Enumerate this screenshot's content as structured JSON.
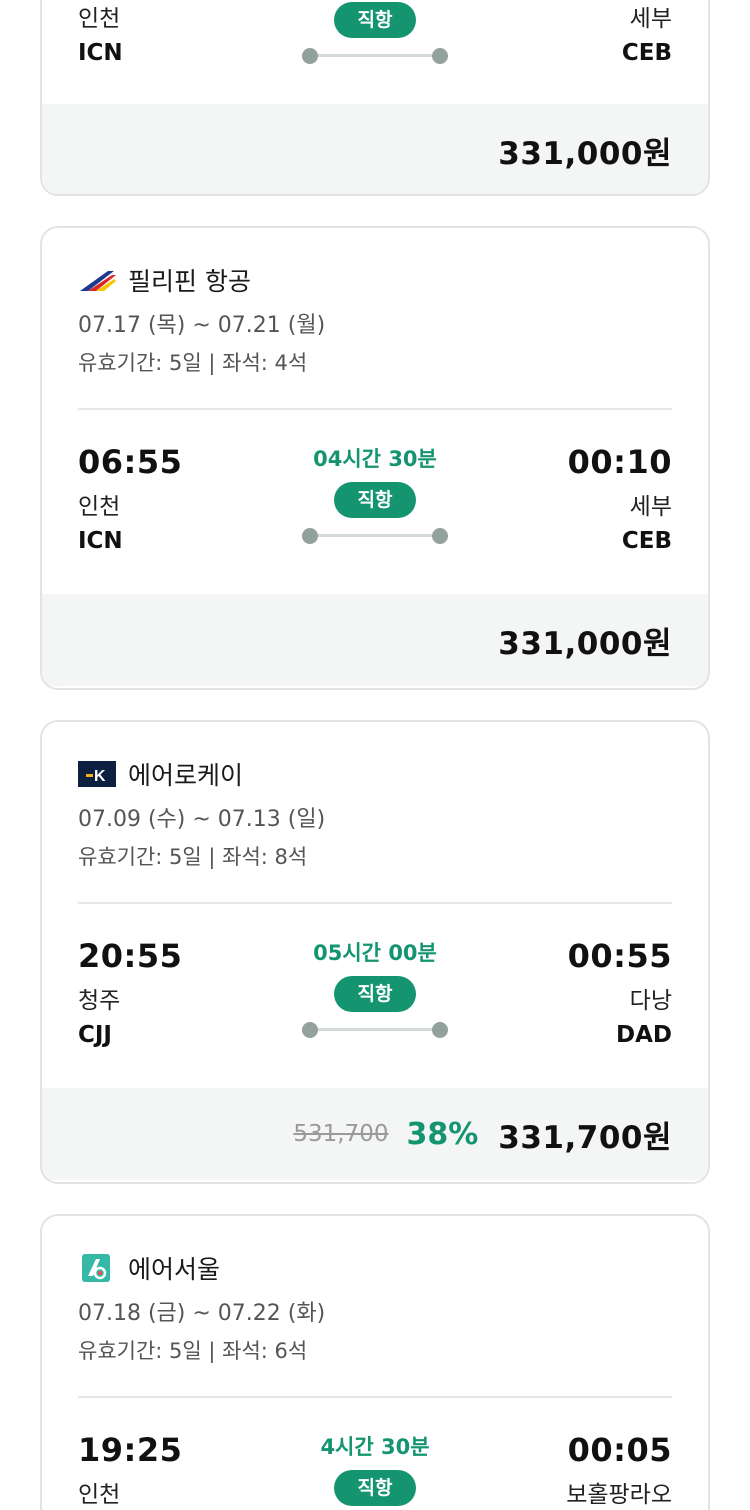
{
  "cards": [
    {
      "dep": {
        "city": "인천",
        "code": "ICN"
      },
      "arr": {
        "city": "세부",
        "code": "CEB"
      },
      "badge": "직항",
      "price": "331,000원"
    },
    {
      "airline": "필리핀 항공",
      "dates": "07.17 (목) ~ 07.21 (월)",
      "validity": "유효기간: 5일 | 좌석: 4석",
      "dep": {
        "time": "06:55",
        "city": "인천",
        "code": "ICN"
      },
      "arr": {
        "time": "00:10",
        "city": "세부",
        "code": "CEB"
      },
      "duration": "04시간 30분",
      "badge": "직항",
      "price": "331,000원"
    },
    {
      "airline": "에어로케이",
      "dates": "07.09 (수) ~ 07.13 (일)",
      "validity": "유효기간: 5일 | 좌석: 8석",
      "dep": {
        "time": "20:55",
        "city": "청주",
        "code": "CJJ"
      },
      "arr": {
        "time": "00:55",
        "city": "다낭",
        "code": "DAD"
      },
      "duration": "05시간 00분",
      "badge": "직항",
      "original_price": "531,700",
      "discount": "38%",
      "price": "331,700원"
    },
    {
      "airline": "에어서울",
      "dates": "07.18 (금) ~ 07.22 (화)",
      "validity": "유효기간: 5일 | 좌석: 6석",
      "dep": {
        "time": "19:25",
        "city": "인천"
      },
      "arr": {
        "time": "00:05",
        "city": "보홀팡라오"
      },
      "duration": "4시간 30분",
      "badge": "직항"
    }
  ],
  "colors": {
    "accent": "#14956f",
    "route_dot": "#92a19c",
    "price_bar": "#f4f5f5"
  },
  "icons": [
    "philippine-airlines-logo-icon",
    "aerok-logo-icon",
    "air-seoul-logo-icon"
  ]
}
